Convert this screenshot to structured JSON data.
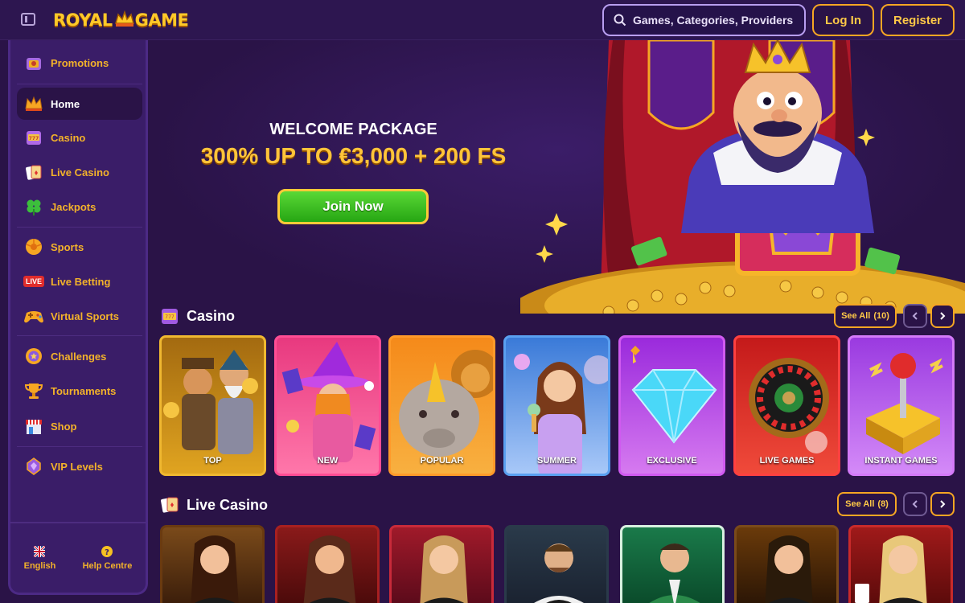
{
  "header": {
    "logo_left": "ROYAL",
    "logo_right": "GAME",
    "search_placeholder": "Games, Categories, Providers",
    "login_label": "Log In",
    "register_label": "Register"
  },
  "sidebar": {
    "items": [
      {
        "label": "Promotions",
        "icon": "gift-icon"
      },
      {
        "label": "Home",
        "icon": "crown-icon"
      },
      {
        "label": "Casino",
        "icon": "slot-machine-icon"
      },
      {
        "label": "Live Casino",
        "icon": "cards-icon"
      },
      {
        "label": "Jackpots",
        "icon": "clover-icon"
      },
      {
        "label": "Sports",
        "icon": "ball-icon"
      },
      {
        "label": "Live Betting",
        "icon": "live-badge-icon"
      },
      {
        "label": "Virtual Sports",
        "icon": "gamepad-icon"
      },
      {
        "label": "Challenges",
        "icon": "medal-icon"
      },
      {
        "label": "Tournaments",
        "icon": "trophy-icon"
      },
      {
        "label": "Shop",
        "icon": "shop-icon"
      },
      {
        "label": "VIP Levels",
        "icon": "vip-gem-icon"
      }
    ],
    "language_label": "English",
    "help_label": "Help Centre",
    "live_badge_text": "LIVE"
  },
  "hero": {
    "title": "WELCOME PACKAGE",
    "subtitle": "300% UP TO €3,000 + 200 FS",
    "cta_label": "Join Now"
  },
  "casino_section": {
    "title": "Casino",
    "see_all_label": "See All",
    "see_all_count": "(10)",
    "cards": [
      {
        "label": "TOP",
        "color": "#e0a420"
      },
      {
        "label": "NEW",
        "color": "#e8397f"
      },
      {
        "label": "POPULAR",
        "color": "#f0861c"
      },
      {
        "label": "SUMMER",
        "color": "#4f8fe0"
      },
      {
        "label": "EXCLUSIVE",
        "color": "#b23ee0"
      },
      {
        "label": "LIVE GAMES",
        "color": "#e02c2c"
      },
      {
        "label": "INSTANT GAMES",
        "color": "#b24fe8"
      }
    ]
  },
  "live_section": {
    "title": "Live Casino",
    "see_all_label": "See All",
    "see_all_count": "(8)"
  },
  "colors": {
    "accent": "#f6a623",
    "background": "#2a1347",
    "sidebar": "#3a1d68",
    "cta_green": "#3cc024"
  }
}
